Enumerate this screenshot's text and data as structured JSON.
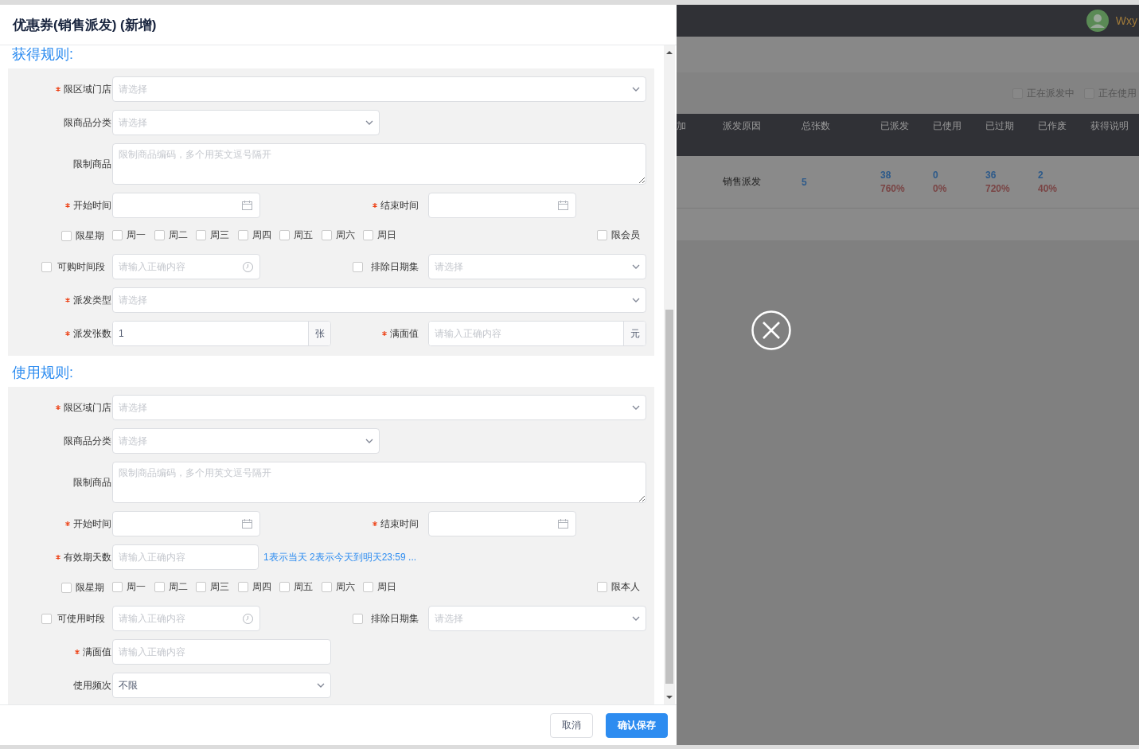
{
  "dialog": {
    "title": "优惠券(销售派发) (新增)",
    "sections": [
      {
        "title": "获得规则:",
        "rows": [
          {
            "kind": "fields",
            "fields": [
              {
                "label": "限区域门店",
                "required": true,
                "control": {
                  "kind": "select-full",
                  "placeholder": "请选择"
                }
              }
            ]
          },
          {
            "kind": "fields",
            "fields": [
              {
                "label": "限商品分类",
                "required": false,
                "control": {
                  "kind": "select-mid",
                  "placeholder": "请选择"
                }
              }
            ]
          },
          {
            "kind": "fields",
            "fields": [
              {
                "label": "限制商品",
                "required": false,
                "control": {
                  "kind": "textarea",
                  "placeholder": "限制商品编码，多个用英文逗号隔开"
                }
              }
            ]
          },
          {
            "kind": "fields",
            "fields": [
              {
                "label": "开始时间",
                "required": true,
                "control": {
                  "kind": "date"
                }
              },
              {
                "label": "结束时间",
                "required": true,
                "control": {
                  "kind": "date"
                }
              }
            ]
          },
          {
            "kind": "weekdays",
            "toggle": {
              "label": "限星期",
              "checked": false
            },
            "days": [
              {
                "label": "周一",
                "checked": false
              },
              {
                "label": "周二",
                "checked": false
              },
              {
                "label": "周三",
                "checked": false
              },
              {
                "label": "周四",
                "checked": false
              },
              {
                "label": "周五",
                "checked": false
              },
              {
                "label": "周六",
                "checked": false
              },
              {
                "label": "周日",
                "checked": false
              }
            ],
            "extra": {
              "label": "限会员",
              "checked": false
            }
          },
          {
            "kind": "fields",
            "fields": [
              {
                "label": "可购时间段",
                "required": false,
                "checked": false,
                "control": {
                  "kind": "time",
                  "placeholder": "请输入正确内容"
                }
              },
              {
                "label": "排除日期集",
                "required": false,
                "checked": false,
                "control": {
                  "kind": "select",
                  "placeholder": "请选择"
                }
              }
            ]
          },
          {
            "kind": "fields",
            "fields": [
              {
                "label": "派发类型",
                "required": true,
                "control": {
                  "kind": "select-full",
                  "placeholder": "请选择"
                }
              }
            ]
          },
          {
            "kind": "fields",
            "fields": [
              {
                "label": "派发张数",
                "required": true,
                "control": {
                  "kind": "input",
                  "value": "1",
                  "suffix": "张"
                }
              },
              {
                "label": "满面值",
                "required": true,
                "control": {
                  "kind": "input",
                  "placeholder": "请输入正确内容",
                  "suffix": "元"
                }
              }
            ]
          }
        ]
      },
      {
        "title": "使用规则:",
        "rows": [
          {
            "kind": "fields",
            "fields": [
              {
                "label": "限区域门店",
                "required": true,
                "control": {
                  "kind": "select-full",
                  "placeholder": "请选择"
                }
              }
            ]
          },
          {
            "kind": "fields",
            "fields": [
              {
                "label": "限商品分类",
                "required": false,
                "control": {
                  "kind": "select-mid",
                  "placeholder": "请选择"
                }
              }
            ]
          },
          {
            "kind": "fields",
            "fields": [
              {
                "label": "限制商品",
                "required": false,
                "control": {
                  "kind": "textarea",
                  "placeholder": "限制商品编码，多个用英文逗号隔开"
                }
              }
            ]
          },
          {
            "kind": "fields",
            "fields": [
              {
                "label": "开始时间",
                "required": true,
                "control": {
                  "kind": "date"
                }
              },
              {
                "label": "结束时间",
                "required": true,
                "control": {
                  "kind": "date"
                }
              }
            ]
          },
          {
            "kind": "fields",
            "fields": [
              {
                "label": "有效期天数",
                "required": true,
                "control": {
                  "kind": "input-short",
                  "placeholder": "请输入正确内容",
                  "hint": "1表示当天 2表示今天到明天23:59 ..."
                }
              }
            ]
          },
          {
            "kind": "weekdays",
            "toggle": {
              "label": "限星期",
              "checked": false
            },
            "days": [
              {
                "label": "周一",
                "checked": false
              },
              {
                "label": "周二",
                "checked": false
              },
              {
                "label": "周三",
                "checked": false
              },
              {
                "label": "周四",
                "checked": false
              },
              {
                "label": "周五",
                "checked": false
              },
              {
                "label": "周六",
                "checked": false
              },
              {
                "label": "周日",
                "checked": false
              }
            ],
            "extra": {
              "label": "限本人",
              "checked": false
            }
          },
          {
            "kind": "fields",
            "fields": [
              {
                "label": "可使用时段",
                "required": false,
                "checked": false,
                "control": {
                  "kind": "time",
                  "placeholder": "请输入正确内容"
                }
              },
              {
                "label": "排除日期集",
                "required": false,
                "checked": false,
                "control": {
                  "kind": "select",
                  "placeholder": "请选择"
                }
              }
            ]
          },
          {
            "kind": "fields",
            "fields": [
              {
                "label": "满面值",
                "required": true,
                "control": {
                  "kind": "input",
                  "placeholder": "请输入正确内容"
                }
              }
            ]
          },
          {
            "kind": "fields",
            "fields": [
              {
                "label": "使用频次",
                "required": false,
                "control": {
                  "kind": "select",
                  "value": "不限"
                }
              }
            ]
          }
        ]
      }
    ],
    "buttons": [
      {
        "label": "取消",
        "kind": "default"
      },
      {
        "label": "确认保存",
        "kind": "primary"
      }
    ]
  },
  "background": {
    "user": "Wxy",
    "filters": [
      {
        "label": "正在派发中",
        "checked": false
      },
      {
        "label": "正在使用",
        "checked": false
      }
    ],
    "table": {
      "columns": [
        "加",
        "派发原因",
        "总张数",
        "已派发",
        "已使用",
        "已过期",
        "已作废",
        "获得说明"
      ],
      "rows": [
        {
          "reason": "销售派发",
          "total": "5",
          "stats": [
            {
              "count": "38",
              "rate": "760%"
            },
            {
              "count": "0",
              "rate": "0%"
            },
            {
              "count": "36",
              "rate": "720%"
            },
            {
              "count": "2",
              "rate": "40%"
            }
          ]
        }
      ]
    }
  }
}
